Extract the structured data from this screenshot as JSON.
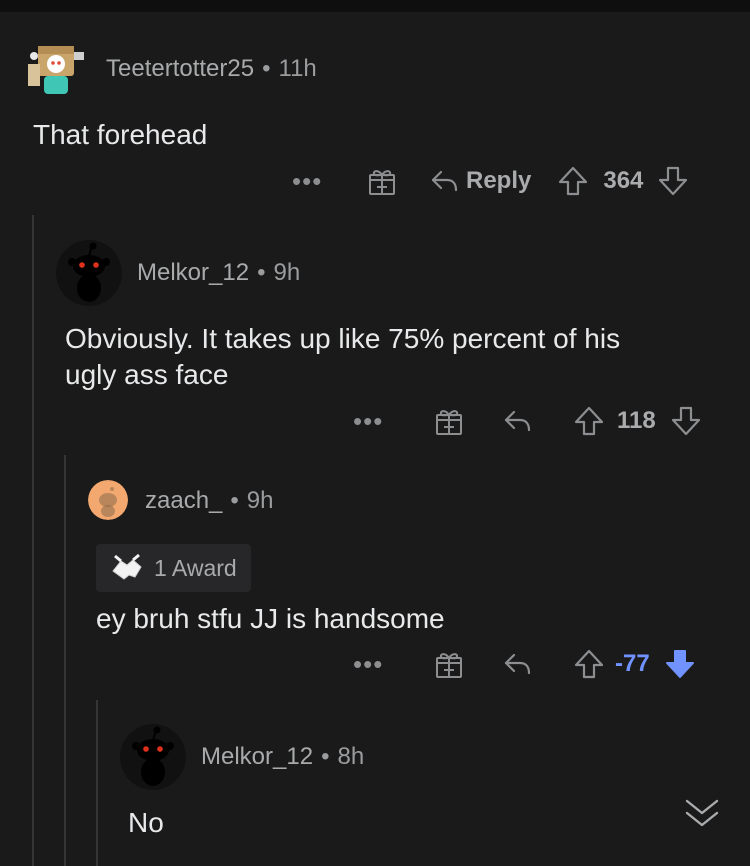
{
  "comments": [
    {
      "author": "Teetertotter25",
      "age": "11h",
      "text": "That forehead",
      "reply_label": "Reply",
      "score": "364"
    },
    {
      "author": "Melkor_12",
      "age": "9h",
      "text_lines": [
        "Obviously. It takes up like 75% percent of his",
        "ugly ass face"
      ],
      "score": "118"
    },
    {
      "author": "zaach_",
      "age": "9h",
      "award_label": "1 Award",
      "text": "ey bruh stfu JJ is handsome",
      "score": "-77"
    },
    {
      "author": "Melkor_12",
      "age": "8h",
      "text": "No"
    }
  ],
  "separator": "•",
  "more_label": "•••",
  "colors": {
    "downvote_active": "#7193ff",
    "background": "#1a1a1b"
  },
  "icons": [
    "more-icon",
    "gift-icon",
    "reply-icon",
    "upvote-icon",
    "downvote-icon",
    "award-icon",
    "chevron-double-down-icon"
  ]
}
